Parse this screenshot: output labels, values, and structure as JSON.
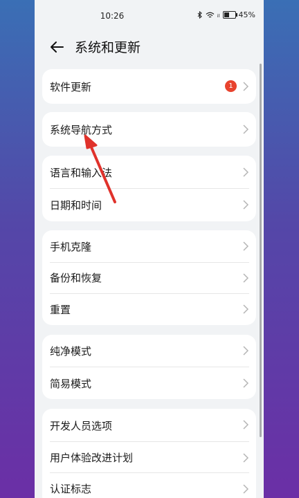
{
  "status_bar": {
    "time": "10:26",
    "battery": "45%",
    "signal": "ᵢₗ"
  },
  "header": {
    "title": "系统和更新"
  },
  "groups": [
    {
      "items": [
        {
          "label": "软件更新",
          "badge": "1"
        }
      ]
    },
    {
      "items": [
        {
          "label": "系统导航方式"
        }
      ]
    },
    {
      "items": [
        {
          "label": "语言和输入法"
        },
        {
          "label": "日期和时间"
        }
      ]
    },
    {
      "items": [
        {
          "label": "手机克隆"
        },
        {
          "label": "备份和恢复"
        },
        {
          "label": "重置"
        }
      ]
    },
    {
      "items": [
        {
          "label": "纯净模式"
        },
        {
          "label": "简易模式"
        }
      ]
    },
    {
      "items": [
        {
          "label": "开发人员选项"
        },
        {
          "label": "用户体验改进计划"
        },
        {
          "label": "认证标志"
        }
      ]
    }
  ],
  "colors": {
    "badge": "#e8432e",
    "arrow": "#e0322b",
    "chevron": "#b5b5b5"
  },
  "icons": {
    "back": "back-arrow-icon",
    "chevron": "chevron-right-icon",
    "bluetooth": "bluetooth-icon",
    "wifi": "wifi-icon",
    "battery": "battery-icon"
  }
}
